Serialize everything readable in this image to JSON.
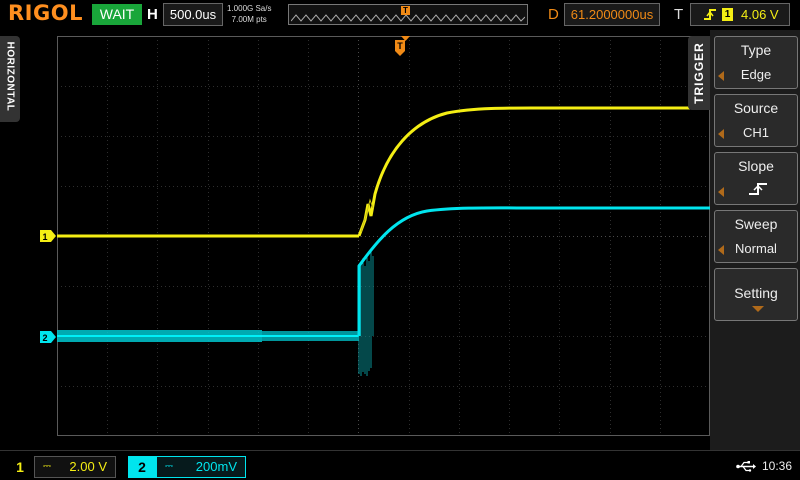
{
  "top": {
    "brand": "RIGOL",
    "run_status": "WAIT",
    "h_label": "H",
    "timebase": "500.0us",
    "sample_rate": "1.000G Sa/s",
    "memory_depth": "7.00M pts",
    "mem_marker": "T",
    "d_label": "D",
    "delay": "61.2000000us",
    "t_label": "T",
    "trigger_channel": "1",
    "trigger_level": "4.06 V"
  },
  "left_tab": {
    "label": "HORIZONTAL"
  },
  "plot": {
    "trigger_marker": "T",
    "ch1_marker": "1",
    "ch2_marker": "2"
  },
  "menu": {
    "tab_label": "TRIGGER",
    "items": [
      {
        "title": "Type",
        "value": "Edge"
      },
      {
        "title": "Source",
        "value": "CH1"
      },
      {
        "title": "Slope",
        "value": ""
      },
      {
        "title": "Sweep",
        "value": "Normal"
      },
      {
        "title": "Setting",
        "value": ""
      }
    ]
  },
  "bottom": {
    "ch1": {
      "num": "1",
      "scale": "2.00 V"
    },
    "ch2": {
      "num": "2",
      "scale": "200mV"
    },
    "time": "10:36"
  },
  "colors": {
    "ch1": "#f4ee14",
    "ch2": "#00e5ee",
    "accent": "#f08a16",
    "run": "#19a63a",
    "brand": "#ff8f1f"
  },
  "icons": {
    "slope": "rising-edge-icon",
    "usb": "usb-icon"
  }
}
